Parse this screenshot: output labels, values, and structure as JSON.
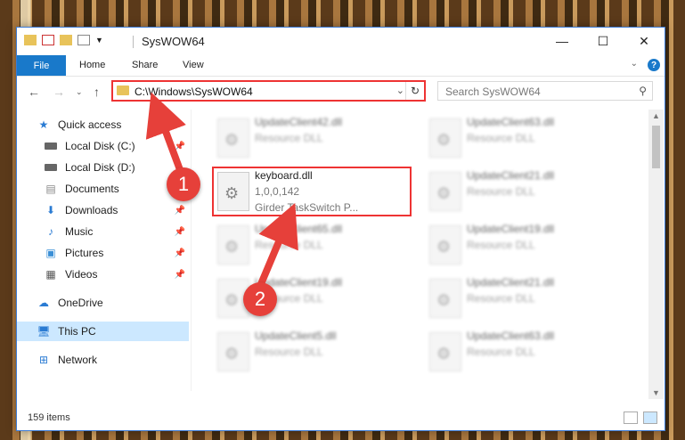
{
  "window": {
    "title": "SysWOW64",
    "controls": {
      "minimize": "—",
      "maximize": "☐",
      "close": "✕"
    }
  },
  "ribbon": {
    "file": "File",
    "tabs": [
      "Home",
      "Share",
      "View"
    ]
  },
  "navbar": {
    "address": "C:\\Windows\\SysWOW64",
    "search_placeholder": "Search SysWOW64"
  },
  "sidebar": {
    "items": [
      {
        "label": "Quick access",
        "icon": "star-icon"
      },
      {
        "label": "Local Disk (C:)",
        "icon": "drive-icon"
      },
      {
        "label": "Local Disk (D:)",
        "icon": "drive-icon"
      },
      {
        "label": "Documents",
        "icon": "documents-icon"
      },
      {
        "label": "Downloads",
        "icon": "download-icon"
      },
      {
        "label": "Music",
        "icon": "music-icon"
      },
      {
        "label": "Pictures",
        "icon": "pictures-icon"
      },
      {
        "label": "Videos",
        "icon": "videos-icon"
      },
      {
        "label": "OneDrive",
        "icon": "cloud-icon"
      },
      {
        "label": "This PC",
        "icon": "computer-icon"
      },
      {
        "label": "Network",
        "icon": "network-icon"
      }
    ]
  },
  "files": [
    {
      "name": "UpdateClient42.dll",
      "line2": "Resource DLL",
      "line3": ""
    },
    {
      "name": "UpdateClient63.dll",
      "line2": "Resource DLL",
      "line3": ""
    },
    {
      "name": "keyboard.dll",
      "line2": "1,0,0,142",
      "line3": "Girder TaskSwitch P..."
    },
    {
      "name": "UpdateClient21.dll",
      "line2": "Resource DLL",
      "line3": ""
    },
    {
      "name": "UpdateClient65.dll",
      "line2": "Resource DLL",
      "line3": ""
    },
    {
      "name": "UpdateClient19.dll",
      "line2": "Resource DLL",
      "line3": ""
    },
    {
      "name": "UpdateClient19.dll",
      "line2": "Resource DLL",
      "line3": ""
    },
    {
      "name": "UpdateClient21.dll",
      "line2": "Resource DLL",
      "line3": ""
    },
    {
      "name": "UpdateClient5.dll",
      "line2": "Resource DLL",
      "line3": ""
    },
    {
      "name": "UpdateClient63.dll",
      "line2": "Resource DLL",
      "line3": ""
    }
  ],
  "status": {
    "count": "159 items"
  },
  "callouts": [
    "1",
    "2"
  ],
  "colors": {
    "accent": "#1979ca",
    "highlight": "#e33333",
    "callout": "#e6403a"
  }
}
